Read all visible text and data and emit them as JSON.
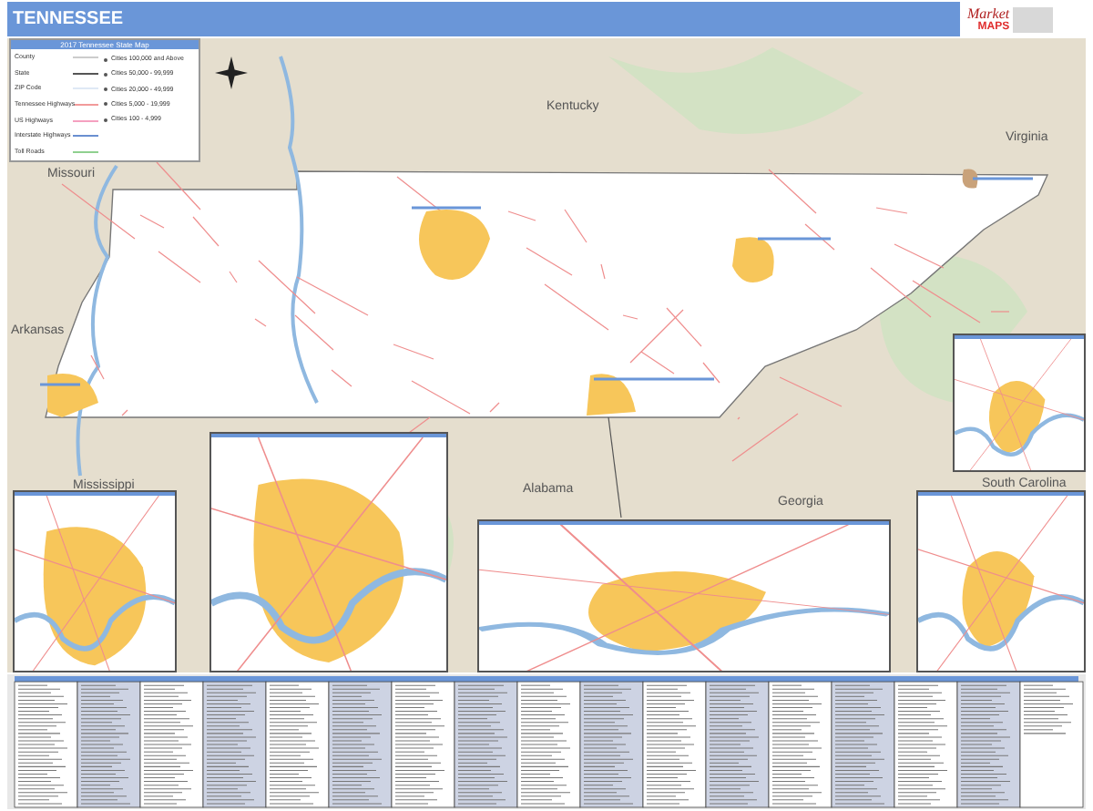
{
  "title": "TENNESSEE",
  "logo": {
    "word": "Market",
    "brand": "MAPS"
  },
  "legend": {
    "title": "2017 Tennessee State Map",
    "items": [
      {
        "label": "County",
        "kind": "county"
      },
      {
        "label": "State",
        "kind": "state"
      },
      {
        "label": "ZIP Code",
        "kind": "zip"
      },
      {
        "label": "Tennessee Highways",
        "kind": "statehwy"
      },
      {
        "label": "US Highways",
        "kind": "ushwy"
      },
      {
        "label": "Interstate Highways",
        "kind": "interstate"
      },
      {
        "label": "Toll Roads",
        "kind": "toll"
      }
    ],
    "city_sizes": [
      "Cities 100,000 and Above",
      "Cities 50,000 - 99,999",
      "Cities 20,000 - 49,999",
      "Cities 5,000 - 19,999",
      "Cities 100 - 4,999"
    ]
  },
  "neighbor_labels": [
    "Kentucky",
    "Virginia",
    "Missouri",
    "Arkansas",
    "Mississippi",
    "Alabama",
    "Georgia",
    "South Carolina"
  ]
}
